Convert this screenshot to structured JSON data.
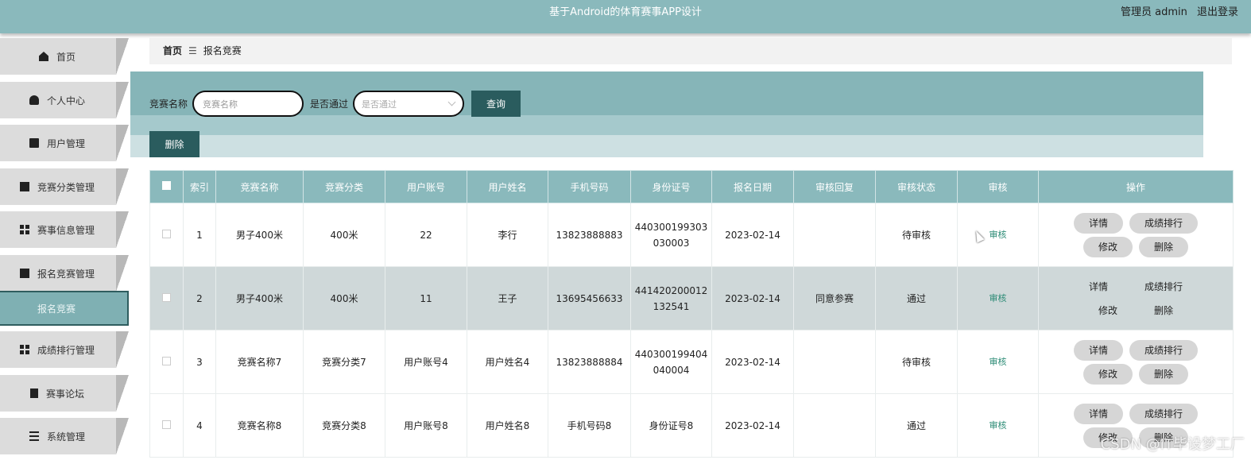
{
  "header": {
    "title": "基于Android的体育赛事APP设计",
    "user_label": "管理员 admin",
    "logout_label": "退出登录"
  },
  "sidebar": {
    "items": [
      {
        "label": "首页",
        "icon": "home-icon"
      },
      {
        "label": "个人中心",
        "icon": "person-icon"
      },
      {
        "label": "用户管理",
        "icon": "chat-icon"
      },
      {
        "label": "竞赛分类管理",
        "icon": "clipboard-x-icon"
      },
      {
        "label": "赛事信息管理",
        "icon": "grid-icon"
      },
      {
        "label": "报名竞赛管理",
        "icon": "clipboard-check-icon"
      },
      {
        "label": "成绩排行管理",
        "icon": "grid-icon"
      },
      {
        "label": "赛事论坛",
        "icon": "signpost-icon"
      },
      {
        "label": "系统管理",
        "icon": "menu-lines-icon"
      }
    ],
    "active_submenu": "报名竞赛"
  },
  "breadcrumb": {
    "home": "首页",
    "separator": "☰",
    "current": "报名竞赛"
  },
  "search": {
    "name_label": "竞赛名称",
    "name_placeholder": "竞赛名称",
    "name_value": "",
    "pass_label": "是否通过",
    "pass_placeholder": "是否通过",
    "query_button": "查询",
    "delete_button": "删除"
  },
  "table": {
    "columns": [
      "",
      "索引",
      "竞赛名称",
      "竞赛分类",
      "用户账号",
      "用户姓名",
      "手机号码",
      "身份证号",
      "报名日期",
      "审核回复",
      "审核状态",
      "审核",
      "操作"
    ],
    "rows": [
      {
        "index": "1",
        "name": "男子400米",
        "category": "400米",
        "account": "22",
        "username": "李行",
        "phone": "13823888883",
        "id_line1": "440300199303",
        "id_line2": "030003",
        "date": "2023-02-14",
        "reply": "",
        "status": "待审核",
        "audit": "审核"
      },
      {
        "index": "2",
        "name": "男子400米",
        "category": "400米",
        "account": "11",
        "username": "王子",
        "phone": "13695456633",
        "id_line1": "441420200012",
        "id_line2": "132541",
        "date": "2023-02-14",
        "reply": "同意参赛",
        "status": "通过",
        "audit": "审核"
      },
      {
        "index": "3",
        "name": "竞赛名称7",
        "category": "竞赛分类7",
        "account": "用户账号4",
        "username": "用户姓名4",
        "phone": "13823888884",
        "id_line1": "440300199404",
        "id_line2": "040004",
        "date": "2023-02-14",
        "reply": "",
        "status": "待审核",
        "audit": "审核"
      },
      {
        "index": "4",
        "name": "竞赛名称8",
        "category": "竞赛分类8",
        "account": "用户账号8",
        "username": "用户姓名8",
        "phone": "手机号码8",
        "id_line1": "身份证号8",
        "id_line2": "",
        "date": "2023-02-14",
        "reply": "",
        "status": "通过",
        "audit": "审核"
      }
    ],
    "actions": {
      "detail": "详情",
      "ranking": "成绩排行",
      "edit": "修改",
      "delete": "删除"
    }
  },
  "watermark": "CSDN @IT毕设梦工厂",
  "colors": {
    "header": "#8ab9bc",
    "dark_button": "#2a5c5e",
    "audit_link": "#2a8a74"
  }
}
